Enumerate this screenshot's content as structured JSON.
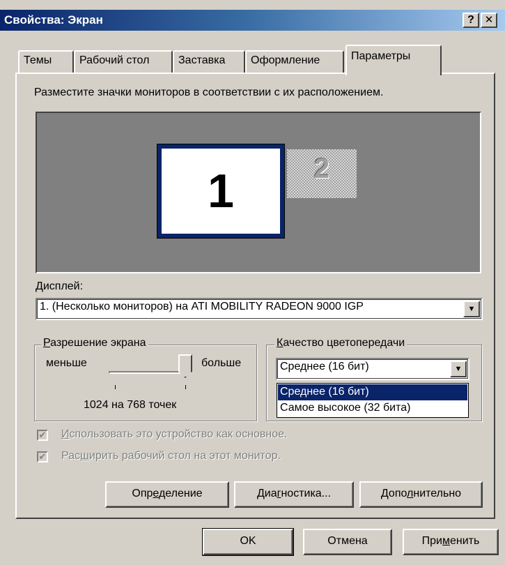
{
  "window": {
    "title": "Свойства: Экран",
    "help_button": "?",
    "close_button": "✕"
  },
  "tabs": [
    {
      "label": "Темы",
      "active": false
    },
    {
      "label": "Рабочий стол",
      "active": false
    },
    {
      "label": "Заставка",
      "active": false
    },
    {
      "label": "Оформление",
      "active": false
    },
    {
      "label": "Параметры",
      "active": true
    }
  ],
  "settings": {
    "instruction": "Разместите значки мониторов в соответствии с их расположением.",
    "monitors": [
      {
        "number": "1",
        "selected": true
      },
      {
        "number": "2",
        "selected": false
      }
    ],
    "display_label": "Дисплей:",
    "display_value": "1. (Несколько мониторов) на ATI MOBILITY RADEON 9000 IGP",
    "resolution": {
      "group_title": "Разрешение экрана",
      "less_label": "меньше",
      "more_label": "больше",
      "slider_level": 1.0,
      "value_text": "1024 на 768 точек"
    },
    "color_quality": {
      "group_title": "Качество цветопередачи",
      "selected": "Среднее (16 бит)",
      "options": [
        "Среднее (16 бит)",
        "Самое высокое (32 бита)"
      ]
    },
    "checkboxes": [
      {
        "label": "Использовать это устройство как основное.",
        "checked": true,
        "enabled": false
      },
      {
        "label": "Расширить рабочий стол на этот монитор.",
        "checked": true,
        "enabled": false
      }
    ],
    "buttons": {
      "identify": "Определение",
      "troubleshoot": "Диагностика...",
      "advanced": "Дополнительно"
    }
  },
  "dialog_buttons": {
    "ok": "OK",
    "cancel": "Отмена",
    "apply": "Применить"
  },
  "colors": {
    "titlebar": "#0a246a",
    "selection": "#0a246a",
    "face": "#d4d0c8",
    "monitor_area": "#808080"
  }
}
